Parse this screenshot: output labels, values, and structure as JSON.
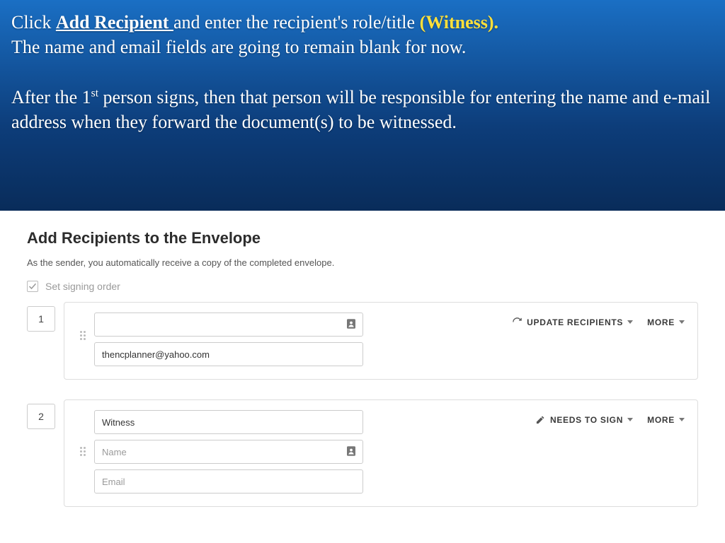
{
  "instructions": {
    "click": "Click ",
    "add_recipient": "Add Recipient ",
    "line1_rest": "and enter the recipient's role/title ",
    "witness": "(Witness).",
    "line2": "The name and email fields are going to remain blank for now.",
    "p2_a": "After the 1",
    "p2_sup": "st",
    "p2_b": " person signs, then that person will be responsible for entering the name and e-mail address when they forward the document(s) to be witnessed."
  },
  "panel": {
    "title": "Add Recipients to the Envelope",
    "subtitle": "As the sender, you automatically receive a copy of the completed envelope.",
    "signing_order_label": "Set signing order"
  },
  "recipients": [
    {
      "order": "1",
      "role": "",
      "name": "",
      "email": "thencplanner@yahoo.com",
      "action_label": "UPDATE RECIPIENTS",
      "action_icon": "refresh-icon"
    },
    {
      "order": "2",
      "role": "Witness",
      "name_placeholder": "Name",
      "email_placeholder": "Email",
      "action_label": "NEEDS TO SIGN",
      "action_icon": "pen-icon"
    }
  ],
  "more_label": "MORE"
}
